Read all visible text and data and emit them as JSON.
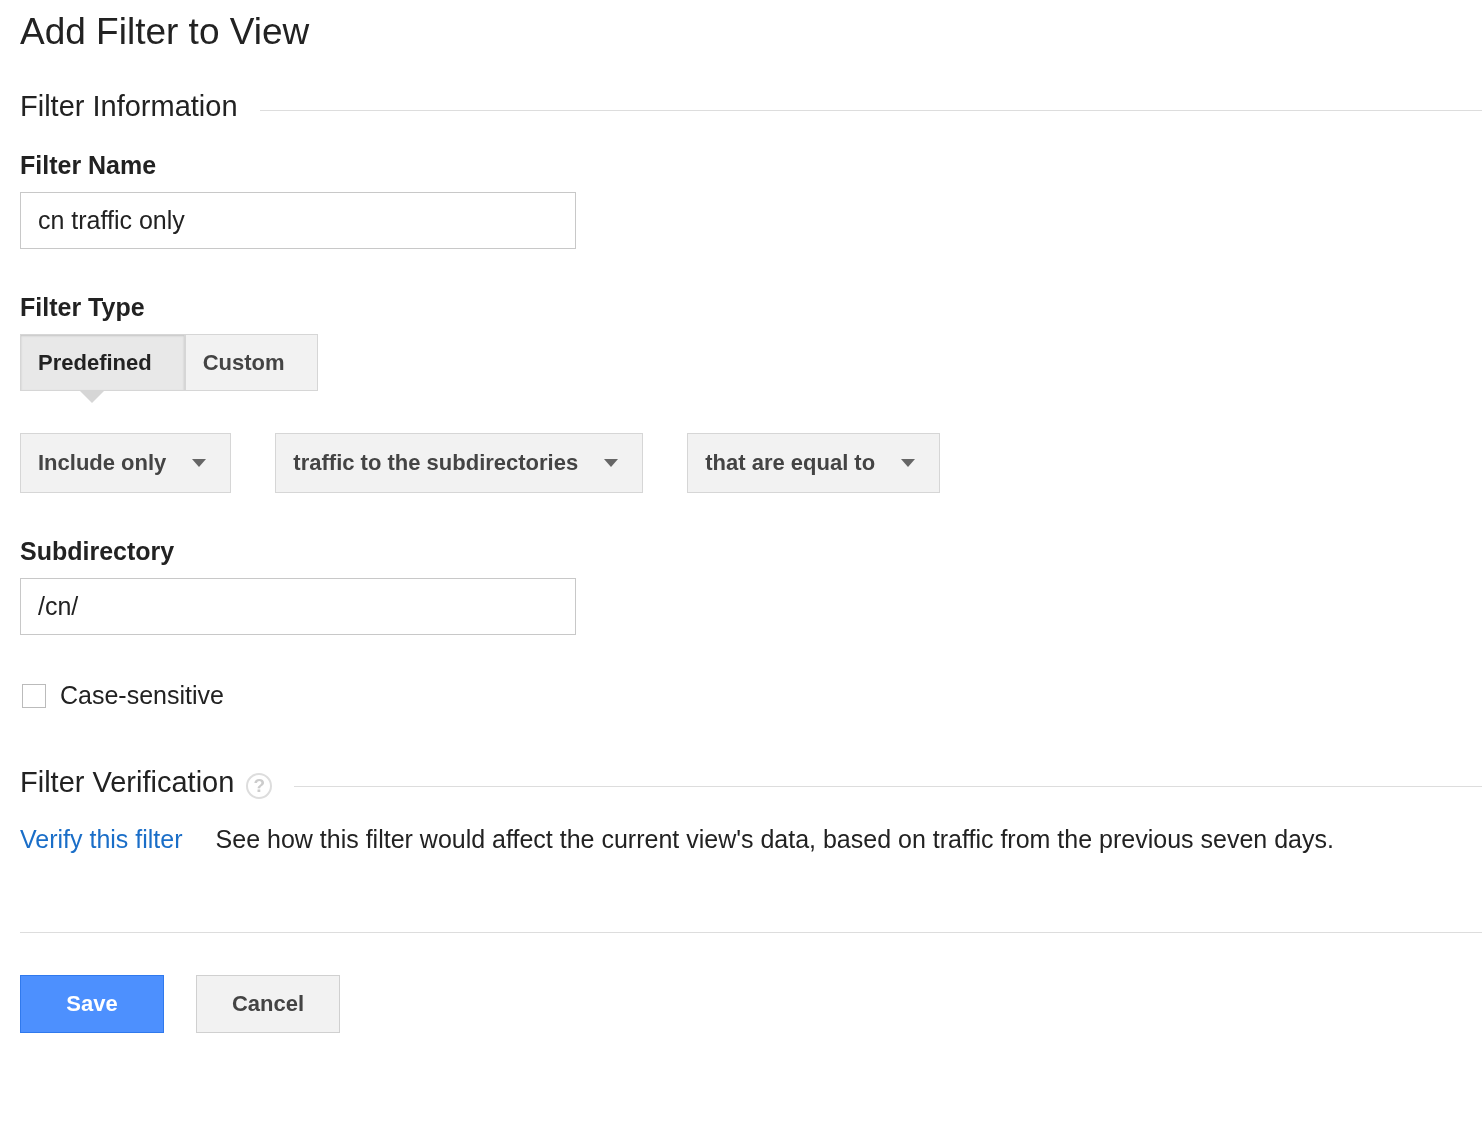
{
  "page": {
    "title": "Add Filter to View"
  },
  "filter_information": {
    "heading": "Filter Information",
    "filter_name": {
      "label": "Filter Name",
      "value": "cn traffic only"
    },
    "filter_type": {
      "label": "Filter Type",
      "options": [
        {
          "label": "Predefined",
          "selected": true
        },
        {
          "label": "Custom",
          "selected": false
        }
      ]
    },
    "dropdowns": [
      {
        "value": "Include only"
      },
      {
        "value": "traffic to the subdirectories"
      },
      {
        "value": "that are equal to"
      }
    ],
    "subdirectory": {
      "label": "Subdirectory",
      "value": "/cn/"
    },
    "case_sensitive": {
      "label": "Case-sensitive",
      "checked": false
    }
  },
  "filter_verification": {
    "heading": "Filter Verification",
    "help_icon": "?",
    "link": "Verify this filter",
    "description": "See how this filter would affect the current view's data, based on traffic from the previous seven days."
  },
  "buttons": [
    {
      "label": "Save",
      "kind": "primary"
    },
    {
      "label": "Cancel",
      "kind": "secondary"
    }
  ]
}
